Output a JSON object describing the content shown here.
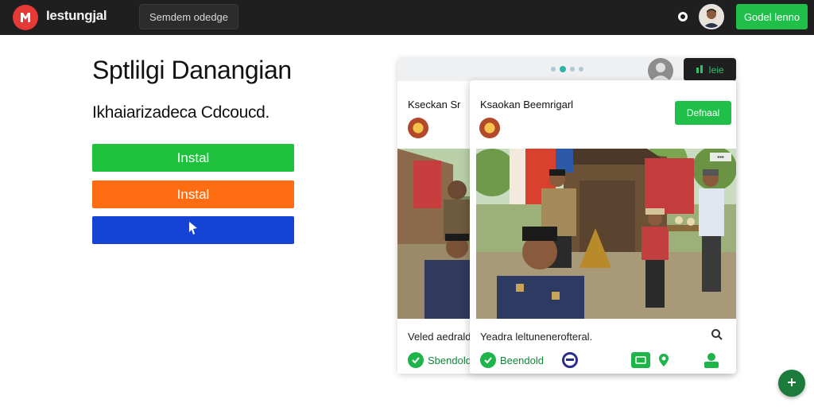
{
  "header": {
    "app_title": "Iestungjal",
    "search_value": "Semdem odedge",
    "cta_label": "Godel lenno"
  },
  "hero": {
    "title": "Sptlilgi Danangian",
    "subtitle": "Ikhaiarizadeca Cdcoucd.",
    "buttons": [
      {
        "label": "Instal",
        "color": "#1ec13c"
      },
      {
        "label": "Instal",
        "color": "#ff6d13"
      },
      {
        "label": "",
        "color": "#1443d6"
      }
    ]
  },
  "card_back": {
    "name": "Kseckan Sr",
    "caption": "Veled aedrald",
    "chip_label": "Sbendold",
    "tag_label": "Ieie"
  },
  "card_front": {
    "name": "Ksaokan Beemrigarl",
    "follow_label": "Defnaal",
    "caption": "Yeadra leltunenerofteral.",
    "chip_label": "Beendold"
  },
  "icons": {
    "logo": "brand-logo-icon",
    "gear": "gear-icon",
    "search": "search-icon",
    "globe": "globe-icon",
    "pin": "location-pin-icon",
    "user": "user-icon",
    "fab": "plus-icon"
  },
  "colors": {
    "accent_green": "#1fbf4a",
    "top_bar": "#1f1f1f",
    "brand_red": "#e53935"
  }
}
